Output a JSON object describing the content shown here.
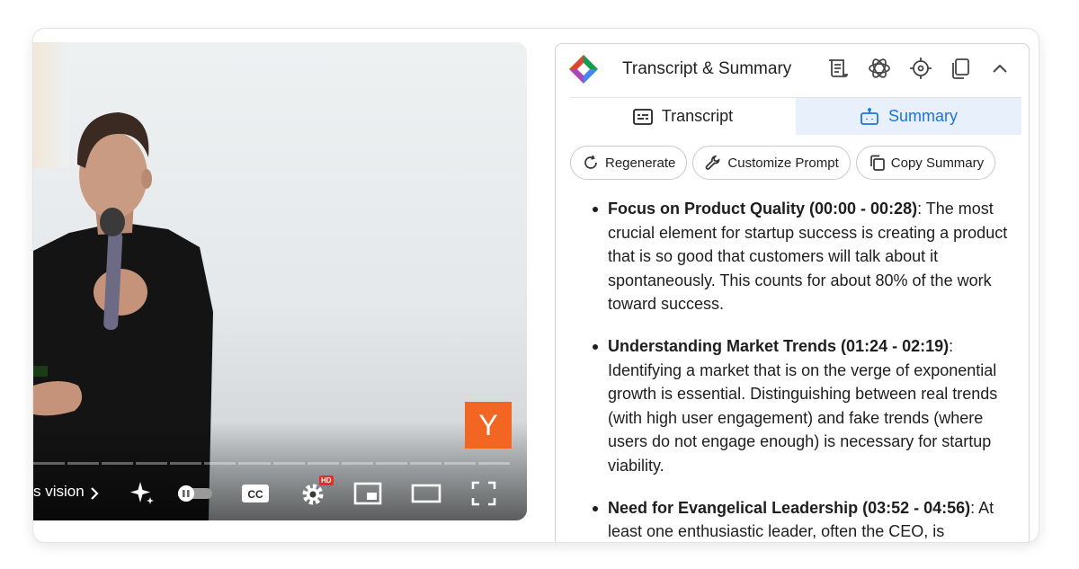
{
  "player": {
    "chapter_text": "s vision",
    "channel_logo_letter": "Y",
    "hd_badge": "HD",
    "controls": [
      "chapter-chevron",
      "sparkle",
      "autoplay-toggle",
      "captions",
      "settings",
      "miniplayer",
      "theater",
      "fullscreen"
    ]
  },
  "panel": {
    "title": "Transcript & Summary",
    "header_icons": [
      "script-icon",
      "chatgpt-icon",
      "crosshair-icon",
      "copy-icon",
      "chevron-up-icon"
    ],
    "tabs": [
      {
        "label": "Transcript",
        "active": false
      },
      {
        "label": "Summary",
        "active": true
      }
    ],
    "actions": {
      "regenerate": "Regenerate",
      "customize": "Customize Prompt",
      "copy": "Copy Summary"
    },
    "summary": [
      {
        "heading": "Focus on Product Quality (00:00 - 00:28)",
        "text": ": The most crucial element for startup success is creating a product that is so good that customers will talk about it spontaneously. This counts for about 80% of the work toward success."
      },
      {
        "heading": "Understanding Market Trends (01:24 - 02:19)",
        "text": ": Identifying a market that is on the verge of exponential growth is essential. Distinguishing between real trends (with high user engagement) and fake trends (where users do not engage enough) is necessary for startup viability."
      },
      {
        "heading": "Need for Evangelical Leadership (03:52 - 04:56)",
        "text": ": At least one enthusiastic leader, often the CEO, is"
      }
    ]
  },
  "colors": {
    "accent": "#1a73e8",
    "active_tab_bg": "#e8f1fb",
    "channel_logo": "#f26522"
  }
}
